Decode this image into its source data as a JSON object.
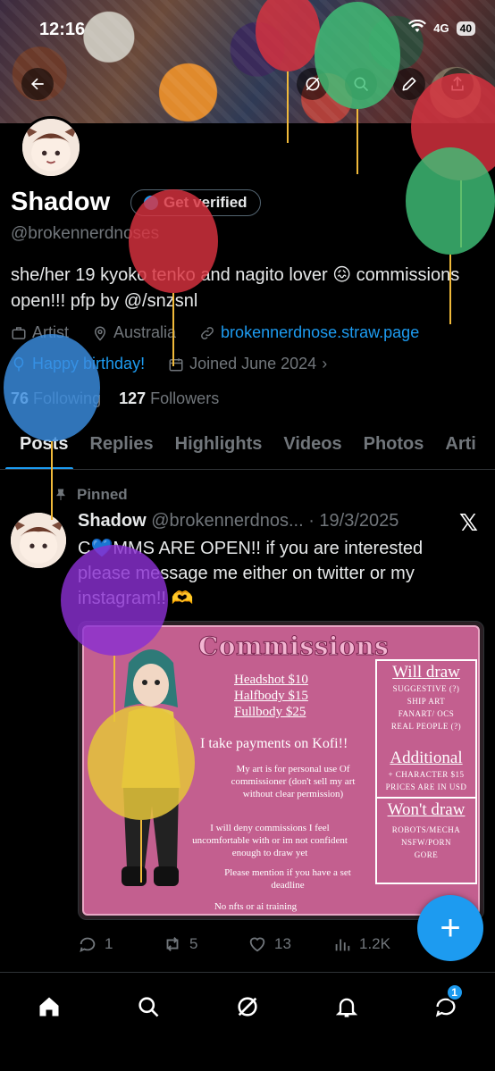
{
  "status_bar": {
    "time": "12:16",
    "network": "4G",
    "battery": "40"
  },
  "header_buttons": {
    "back_icon": "arrow-left-icon",
    "grok_icon": "grok-icon",
    "search_icon": "search-icon",
    "edit_icon": "pencil-icon",
    "share_icon": "share-icon"
  },
  "profile": {
    "name": "Shadow",
    "verify_label": "Get verified",
    "handle": "@brokennerdnoses",
    "bio": "she/her 19 kyoko tenko and nagito lover 😖 commissions open!!! pfp by @/snzsnl",
    "category": "Artist",
    "location": "Australia",
    "link": "brokennerdnose.straw.page",
    "birthday": "Happy birthday!",
    "joined": "Joined June 2024",
    "following_count": "76",
    "following_label": "Following",
    "followers_count": "127",
    "followers_label": "Followers"
  },
  "tabs": [
    {
      "label": "Posts",
      "active": true
    },
    {
      "label": "Replies"
    },
    {
      "label": "Highlights"
    },
    {
      "label": "Videos"
    },
    {
      "label": "Photos"
    },
    {
      "label": "Arti"
    }
  ],
  "post": {
    "pinned_label": "Pinned",
    "author": "Shadow",
    "handle": "@brokennerdnos...",
    "date": "· 19/3/2025",
    "text": "C💙MMS ARE OPEN!! if you are interested please message me either on twitter or my instagram!! 🫶",
    "replies": "1",
    "reposts": "5",
    "likes": "13",
    "views": "1.2K"
  },
  "commission_card": {
    "title": "Commissions",
    "price_1": "Headshot  $10",
    "price_2": "Halfbody  $15",
    "price_3": "Fullbody  $25",
    "payment": "I take payments on Kofi!!",
    "note_1": "My art is for personal use Of commissioner (don't sell my art without clear permission)",
    "note_2": "I will deny commissions I feel uncomfortable with or im not confident enough to draw yet",
    "note_3": "Please mention if you have a set deadline",
    "note_4": "No nfts or ai training",
    "will_draw_title": "Will draw",
    "will_draw_items": "SUGGESTIVE (?)\nSHIP ART\nFANART/ OCS\nREAL PEOPLE (?)",
    "additional_title": "Additional",
    "additional_items": "+ CHARACTER $15\nPRICES ARE IN USD",
    "wont_draw_title": "Won't draw",
    "wont_draw_items": "ROBOTS/MECHA\nNSFW/PORN\nGORE"
  },
  "fab": {
    "label": "+"
  },
  "bottom_nav": {
    "home_icon": "home-icon",
    "search_icon": "search-icon",
    "grok_icon": "grok-icon",
    "notifications_icon": "bell-icon",
    "messages_icon": "messages-icon",
    "messages_badge": "1"
  },
  "colors": {
    "accent": "#1d9bf0",
    "background": "#000000",
    "muted": "#71767b",
    "card_pink": "#c35f8f"
  }
}
